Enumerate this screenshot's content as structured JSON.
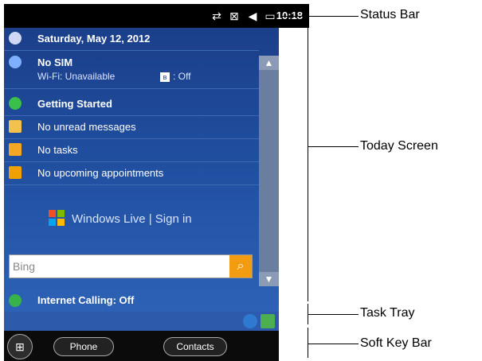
{
  "status_bar": {
    "time": "10:18",
    "icons": [
      "data-sync-icon",
      "signal-off-icon",
      "speaker-mute-icon",
      "battery-icon"
    ]
  },
  "today": {
    "date_label": "Saturday, May 12, 2012",
    "no_sim_label": "No SIM",
    "wifi_label": "Wi-Fi: Unavailable",
    "bluetooth_label": ": Off",
    "getting_started_label": "Getting Started",
    "messages_label": "No unread messages",
    "tasks_label": "No tasks",
    "appointments_label": "No upcoming appointments",
    "windows_live_label": "Windows Live | Sign in",
    "bing_placeholder": "Bing",
    "internet_calling_label": "Internet Calling: Off"
  },
  "soft_keys": {
    "left_label": "Phone",
    "right_label": "Contacts"
  },
  "callouts": {
    "status_bar": "Status Bar",
    "today_screen": "Today Screen",
    "task_tray": "Task Tray",
    "soft_key_bar": "Soft Key Bar"
  },
  "colors": {
    "today_bg_top": "#1b3f8a",
    "today_bg_bottom": "#2d62b6",
    "search_button": "#f39c12",
    "status_bar": "#000000"
  }
}
